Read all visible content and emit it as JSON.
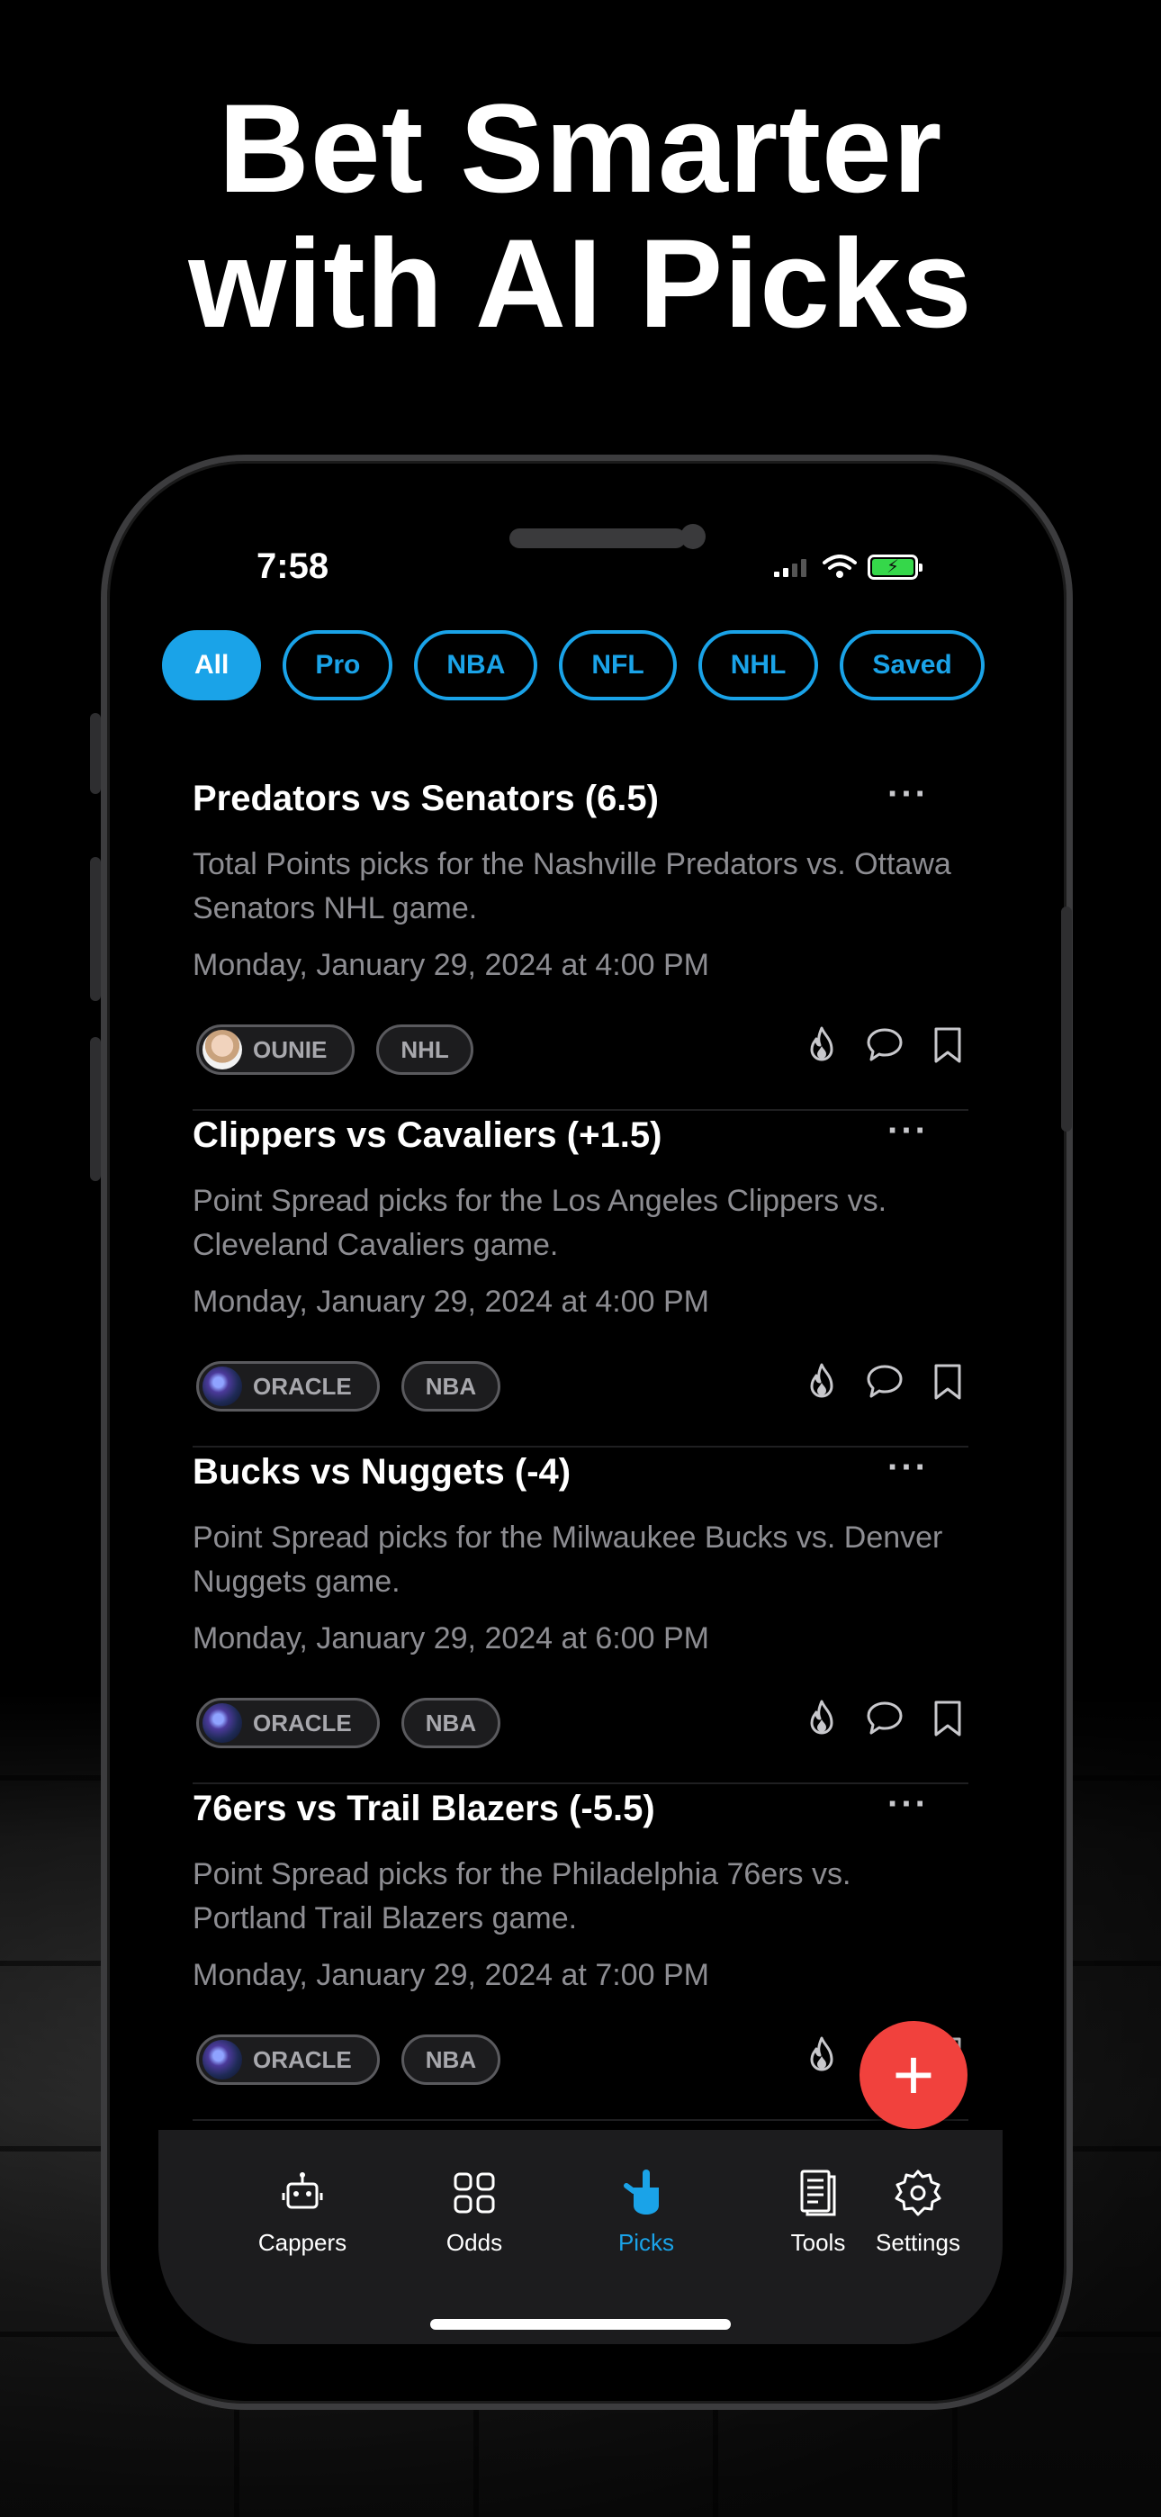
{
  "headline": {
    "line1": "Bet Smarter",
    "line2": "with AI Picks"
  },
  "status_bar": {
    "time": "7:58",
    "battery_color": "#35d74a"
  },
  "filters": [
    {
      "label": "All",
      "active": true
    },
    {
      "label": "Pro",
      "active": false
    },
    {
      "label": "NBA",
      "active": false
    },
    {
      "label": "NFL",
      "active": false
    },
    {
      "label": "NHL",
      "active": false
    },
    {
      "label": "Saved",
      "active": false
    }
  ],
  "picks": [
    {
      "title": "Predators vs Senators (6.5)",
      "description": "Total Points picks for the Nashville Predators vs. Ottawa Senators NHL game.",
      "date": "Monday, January 29, 2024 at 4:00 PM",
      "capper": "OUNIE",
      "league": "NHL"
    },
    {
      "title": "Clippers vs Cavaliers (+1.5)",
      "description": "Point Spread picks for the Los Angeles Clippers vs. Cleveland Cavaliers game.",
      "date": "Monday, January 29, 2024 at 4:00 PM",
      "capper": "ORACLE",
      "league": "NBA"
    },
    {
      "title": "Bucks vs Nuggets (-4)",
      "description": "Point Spread picks for the Milwaukee Bucks vs. Denver Nuggets game.",
      "date": "Monday, January 29, 2024 at 6:00 PM",
      "capper": "ORACLE",
      "league": "NBA"
    },
    {
      "title": "76ers vs Trail Blazers (-5.5)",
      "description": "Point Spread picks for the Philadelphia 76ers vs. Portland Trail Blazers game.",
      "date": "Monday, January 29, 2024 at 7:00 PM",
      "capper": "ORACLE",
      "league": "NBA"
    }
  ],
  "more_label": "···",
  "fab_label": "+",
  "tabs": [
    {
      "label": "Cappers",
      "icon": "robot-icon"
    },
    {
      "label": "Odds",
      "icon": "grid-icon"
    },
    {
      "label": "Picks",
      "icon": "foam-finger-icon",
      "active": true
    },
    {
      "label": "Tools",
      "icon": "document-icon"
    },
    {
      "label": "Settings",
      "icon": "gear-icon"
    }
  ],
  "accent_color": "#1aa3e8",
  "fab_color": "#f1413d"
}
